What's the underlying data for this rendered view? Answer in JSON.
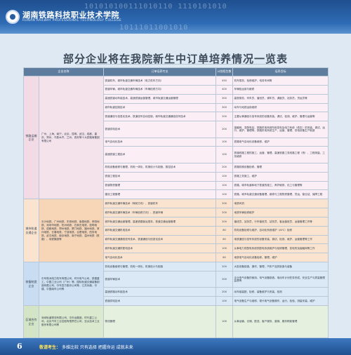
{
  "header": {
    "binary_top": "101010100111010110 1110101010",
    "binary_bottom": "10111011001010",
    "school_cn": "湖南铁路科技职业技术学院",
    "school_en": "HUNAN RAILWAY PROFESSIONAL TECHNOLOGY COLLEGE"
  },
  "title": "部分企业将在我院新生中订单培养情况一览表",
  "table": {
    "headers": [
      "企业名称",
      "订单培养专业",
      "计划招生数",
      "培养目标"
    ],
    "groups": [
      {
        "category": "铁路运输企业",
        "cities": "广州、上海、南宁、北京、昆明、武汉、成都、重庆、郑州、乌鲁木齐、兰州、西安等十大铁路局集团有限公司",
        "rows": [
          [
            "铁道机车、城市轨道交通车辆技术（电力机车方向）",
            "450",
            "机车乘务、检修维护、电务车间等"
          ],
          [
            "铁道车辆、城市轨道交通车辆技术（车辆检修方向）",
            "400",
            "车辆检运用与维修"
          ],
          [
            "高速铁道动车组技术、高速铁道运营管理、城市轨道交通运营管理",
            "300",
            "高铁乘务、列车员、值班员、调车员、调度员、站务员、货运员等"
          ],
          [
            "城市轨道控制技术",
            "300",
            "动车与地铁运用维修"
          ],
          [
            "铁道通信与信息化技术、铁道信号自动控制、城市轨道交通通信信号技术",
            "200",
            "主要从事通信与信号系统的设备安装、调试、检测、维护、管理与运营等"
          ],
          [
            "铁道供电技术",
            "200",
            "接触网、变配电站、铁路供电系统所用变电及电力系统（低压）的安装、调试、运行、维护、管理等。铁路供电系统生产、运营、管理、供电设备生产制造"
          ],
          [
            "电气自动化技术",
            "100",
            "铁路电气自动化设备维修、维护"
          ],
          [
            "高速铁道工程技术",
            "100",
            "铁道线路工程的施工、运营、管理，高速铁路工务线路工程（桥）、工程测量、工务维修"
          ],
          [
            "机电设备维修与管理、机电一体化、机械设计与制造、数控技术",
            "200",
            "铁路机械设备检修、管理"
          ],
          [
            "铁道工程技术",
            "100",
            "铁路工务施工、维护"
          ],
          [
            "铁道物资管理",
            "100",
            "铁路、城市轨道和地下铁道的施工、养护维修、化工与管理等"
          ],
          [
            "建设工程管理",
            "100",
            "铁路、城市轨道交通设备管理、维修与工程物资管理、货运、营业站、保障工程"
          ]
        ]
      },
      {
        "category": "城市轨道交通企业",
        "cities": "长沙地铁、广州地铁、东莞地铁、南昌地铁、贵阳地铁、深圳市地铁、杭州地铁、石家庄地铁、昆明地铁、成都地铁、郑州地铁、厦门地铁、福州地铁、常州地铁、长春地铁、宁波地铁、合肥地铁、西安地铁、武汉地铁、南京地铁、南宁地铁、温州地铁（铁路）、地铁集团等",
        "rows": [
          [
            "城市轨道交通车辆技术（驾驶方向）、铁道机车",
            "200",
            "地铁司机"
          ],
          [
            "城市轨道交通车辆技术（车辆检修方向）、铁道车辆",
            "200",
            "地铁车辆检修维护"
          ],
          [
            "城市轨道交通运营管理、高速铁路客运乘务、铁道交通运营管理",
            "200",
            "值班员、站务员、行车值班员、站务员、客运值班员、运营管理工作等"
          ],
          [
            "城市轨道交通机电技术",
            "80",
            "机电设备检修与维护、自动化系统维护（AFC）检修"
          ],
          [
            "城市轨道交通通信信号技术、铁道通信与信息化技术",
            "80",
            "地铁通信与信号系统的设备安装、调试、检测、维护、运营管理等工作"
          ],
          [
            "城市轨道交通供配电技术",
            "100",
            "从事电力供配电系统供配电系统维护与检修管理、变电所及接触网等工作"
          ],
          [
            "电气自动化技术",
            "80",
            "地铁电气自动化设备检修、管理、维护"
          ]
        ]
      },
      {
        "category": "装备制造企业",
        "cities": "中车株洲电力机车有限公司、时代电气公司、铁建重工、中国工业公司（广州）等、国际轨道交通装备制造有限公司、中车四方股份公司等、江苏永鼎、中建、中国南车公司等",
        "rows": [
          [
            "机电设备维修与管理、机电一体化、机械设计与制造",
            "200",
            "大型设备制造、操作、管理，汽车产品的制造与装备"
          ],
          [
            "铁道车辆技术",
            "200",
            "企业电气设备的使用、电气设备制造、电动车计划任务完成、安全生产与质量管理监督等"
          ],
          [
            "高速铁路动车组技术",
            "200",
            "动车组装配、检修、装备维护与安装、检测"
          ],
          [
            "铁道供电技术",
            "100",
            "电气设备生产与维修、现代电气设备操作、运行、检验、测量安装、维护"
          ]
        ]
      },
      {
        "category": "区域合作企业",
        "cities": "深圳轨道物流有限公司、中外运集团、时代重工公司、北京汽车工业控股有限责任公司、亚太技术工业股份有限公司等",
        "rows": [
          [
            "物流管理",
            "100",
            "从事运输、仓储、配送、客户服务、营销、服务职能管理"
          ]
        ]
      }
    ]
  },
  "footer": {
    "page": "6",
    "text_label": "敬请考生：",
    "text": "多维比较  只有选择  把握命运  成就未来"
  }
}
